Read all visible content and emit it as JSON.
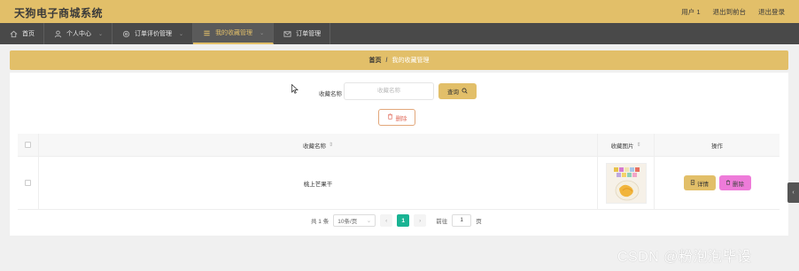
{
  "header": {
    "title": "天狗电子商城系统",
    "links": [
      "用户 1",
      "退出到前台",
      "退出登录"
    ]
  },
  "nav": {
    "items": [
      {
        "label": "首页",
        "icon": "home-icon"
      },
      {
        "label": "个人中心",
        "icon": "user-icon"
      },
      {
        "label": "订单评价管理",
        "icon": "settings-icon"
      },
      {
        "label": "我的收藏管理",
        "icon": "list-icon"
      },
      {
        "label": "订单管理",
        "icon": "mail-icon"
      }
    ],
    "active_index": 3
  },
  "breadcrumb": {
    "home": "首页",
    "separator": "/",
    "current": "我的收藏管理"
  },
  "search": {
    "label": "收藏名称",
    "placeholder": "收藏名称",
    "button_label": "查询"
  },
  "toolbar": {
    "delete_label": "删除"
  },
  "table": {
    "columns": [
      "收藏名称",
      "收藏图片",
      "操作"
    ],
    "rows": [
      {
        "name": "桃上芒果干",
        "detail_label": "详情",
        "delete_label": "删除"
      }
    ]
  },
  "pagination": {
    "total": "共 1 条",
    "page_size": "10条/页",
    "current_page": "1",
    "goto_label": "前往",
    "goto_value": "1",
    "page_suffix": "页"
  },
  "watermark": "CSDN @粉泡泡毕设",
  "colors": {
    "accent": "#e2bf69",
    "nav_bg": "#494949",
    "delete_pink": "#ee7bd9",
    "page_active": "#19b393"
  }
}
